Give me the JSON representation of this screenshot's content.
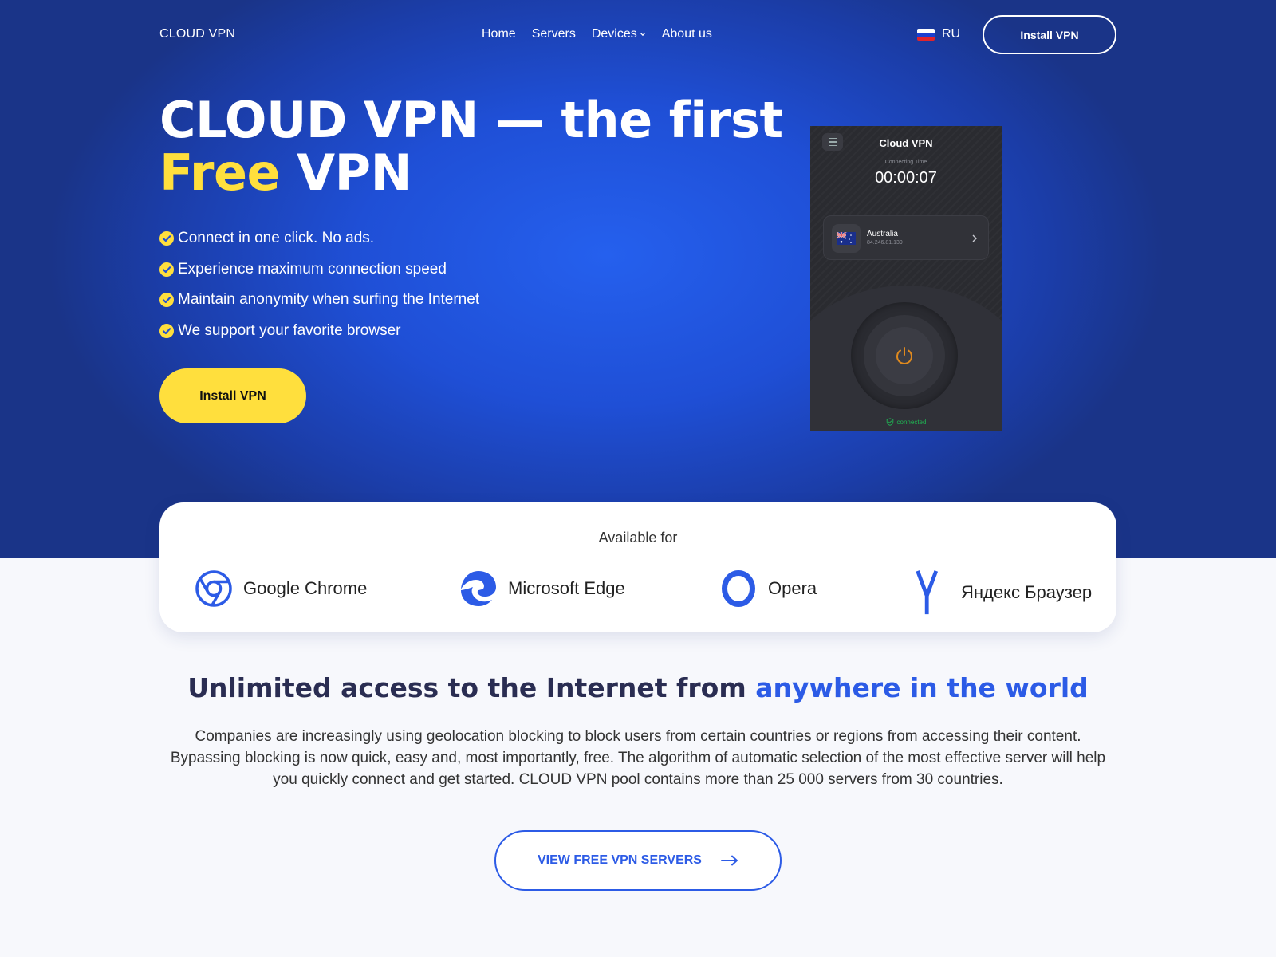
{
  "nav": {
    "brand": "CLOUD VPN",
    "items": [
      {
        "label": "Home"
      },
      {
        "label": "Servers"
      },
      {
        "label": "Devices"
      },
      {
        "label": "About us"
      }
    ],
    "language": "RU",
    "install_label": "Install VPN"
  },
  "hero": {
    "title_line1": "CLOUD VPN — the first",
    "title_highlight": "Free",
    "title_rest": " VPN",
    "features": [
      "Connect in one click. No ads.",
      "Experience maximum connection speed",
      "Maintain anonymity when surfing the Internet",
      "We support your favorite browser"
    ],
    "cta_label": "Install VPN"
  },
  "app": {
    "title": "Cloud VPN",
    "connecting_label": "Connecting Time",
    "timer": "00:00:07",
    "server_name": "Australia",
    "server_ip": "84.246.81.139",
    "status": "connected"
  },
  "availability": {
    "title": "Available for",
    "browsers": [
      {
        "name": "Google Chrome",
        "icon": "chrome-icon"
      },
      {
        "name": "Microsoft Edge",
        "icon": "edge-icon"
      },
      {
        "name": "Opera",
        "icon": "opera-icon"
      },
      {
        "name": "Яндекс Браузер",
        "icon": "yandex-icon"
      }
    ]
  },
  "info": {
    "title_start": "Unlimited access to the Internet from ",
    "title_highlight": "anywhere in the world",
    "text": "Companies are increasingly using geolocation blocking to block users from certain countries or regions from accessing their content. Bypassing blocking is now quick, easy and, most importantly, free. The algorithm of automatic selection of the most effective server will help you quickly connect and get started. CLOUD VPN pool contains more than 25 000 servers from 30 countries.",
    "button_label": "VIEW FREE VPN SERVERS"
  },
  "colors": {
    "accent_yellow": "#ffdf3d",
    "accent_blue": "#2c5be6",
    "hero_blue": "#1f4fd6",
    "connected_green": "#1fb553"
  }
}
